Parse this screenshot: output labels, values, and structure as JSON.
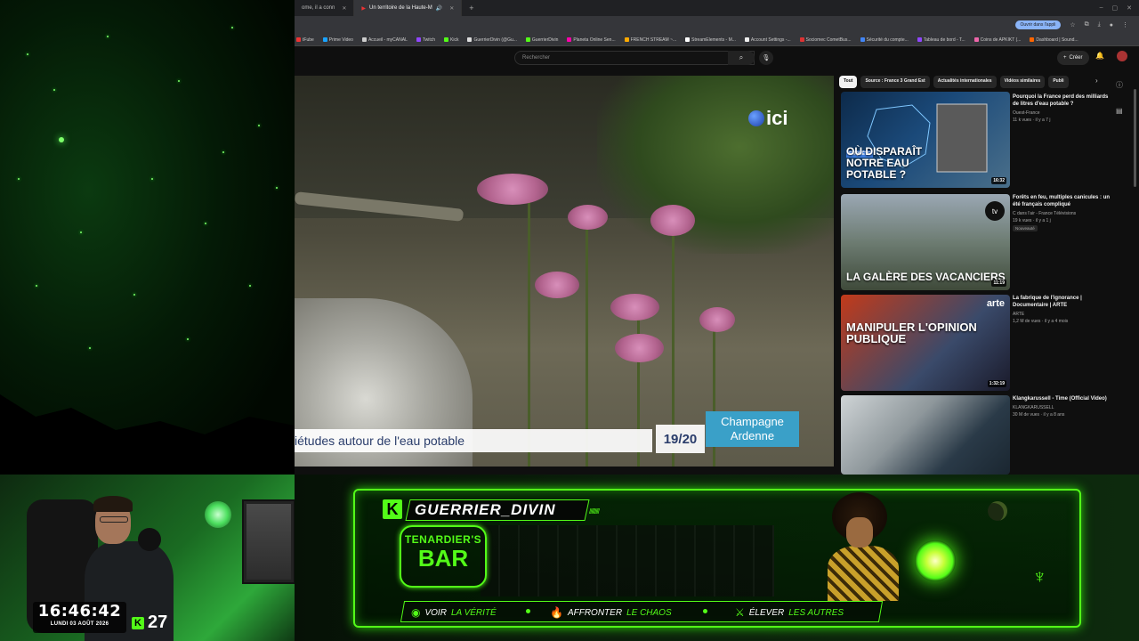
{
  "browser": {
    "tabs": [
      {
        "label": "ome, il a conn"
      },
      {
        "label": "Un territoire de la Haute-M"
      }
    ],
    "window_controls": [
      "‒",
      "▢",
      "✕"
    ],
    "open_app_label": "Ouvrir dans l'appli",
    "bookmarks": [
      {
        "label": "tFube",
        "color": "#e33"
      },
      {
        "label": "Prime Video",
        "color": "#1aa3ff"
      },
      {
        "label": "Accueil - myCANAL",
        "color": "#ccc"
      },
      {
        "label": "Twitch",
        "color": "#9146ff"
      },
      {
        "label": "Kick",
        "color": "#53fc18"
      },
      {
        "label": "GuerrierDivin (@Gu...",
        "color": "#ddd"
      },
      {
        "label": "GuerrierDivin",
        "color": "#53fc18"
      },
      {
        "label": "Planeta Online Sen...",
        "color": "#f0a"
      },
      {
        "label": "FRENCH STREAM ~...",
        "color": "#fa0"
      },
      {
        "label": "StreamElements - M...",
        "color": "#fff"
      },
      {
        "label": "Account Settings -...",
        "color": "#eee"
      },
      {
        "label": "Sociomec CometBus...",
        "color": "#d33"
      },
      {
        "label": "Sécurité du compte...",
        "color": "#4285f4"
      },
      {
        "label": "Tableau de bord - T...",
        "color": "#9146ff"
      },
      {
        "label": "Coins de APKIKT (...",
        "color": "#e6a"
      },
      {
        "label": "Dashboard | Sound...",
        "color": "#f60"
      }
    ]
  },
  "youtube": {
    "search_placeholder": "Rechercher",
    "create_label": "Créer",
    "video": {
      "channel_logo": "ici",
      "lower_third": "iétudes autour de l'eau potable",
      "episode": "19/20",
      "region_line1": "Champagne",
      "region_line2": "Ardenne"
    },
    "chips": [
      "Tout",
      "Source : France 3 Grand Est",
      "Actualités internationales",
      "Vidéos similaires",
      "Publi"
    ],
    "recommendations": [
      {
        "thumb_text": "OÙ DISPARAÎT NOTRE EAU POTABLE ?",
        "badge": "ENQUÊTE",
        "duration": "16:32",
        "title": "Pourquoi la France perd des milliards de litres d'eau potable ?",
        "channel": "Ouest-France",
        "views": "11 k vues · il y a 7 j",
        "new": ""
      },
      {
        "thumb_text": "LA GALÈRE DES VACANCIERS",
        "badge": "",
        "duration": "11:19",
        "title": "Forêts en feu, multiples canicules : un été français compliqué",
        "channel": "C dans l'air - France Télévisions",
        "views": "19 k vues · il y a 1 j",
        "new": "Nouveauté"
      },
      {
        "thumb_text": "MANIPULER L'OPINION PUBLIQUE",
        "badge": "",
        "duration": "1:32:19",
        "title": "La fabrique de l'ignorance | Documentaire | ARTE",
        "channel": "ARTE",
        "views": "1,2 M de vues · il y a 4 mois",
        "new": ""
      },
      {
        "thumb_text": "",
        "badge": "",
        "duration": "",
        "title": "Klangkarussell - Time (Official Video)",
        "channel": "KLANGKARUSSELL",
        "views": "30 M de vues · il y a 8 ans",
        "new": ""
      }
    ]
  },
  "stream": {
    "clock": "16:46:42",
    "date": "LUNDI 03 AOÛT 2026",
    "viewers": "27",
    "kick_letter": "K",
    "username": "GUERRIER_DIVIN",
    "bar_name_line1": "TENARDIER'S",
    "bar_name_line2": "BAR",
    "taglines": [
      {
        "verb": "VOIR",
        "rest": "LA VÉRITÉ",
        "icon": "eye-icon"
      },
      {
        "verb": "AFFRONTER",
        "rest": "LE CHAOS",
        "icon": "fire-icon"
      },
      {
        "verb": "ÉLEVER",
        "rest": "LES AUTRES",
        "icon": "sword-icon"
      }
    ],
    "accent": "#53fc18"
  }
}
